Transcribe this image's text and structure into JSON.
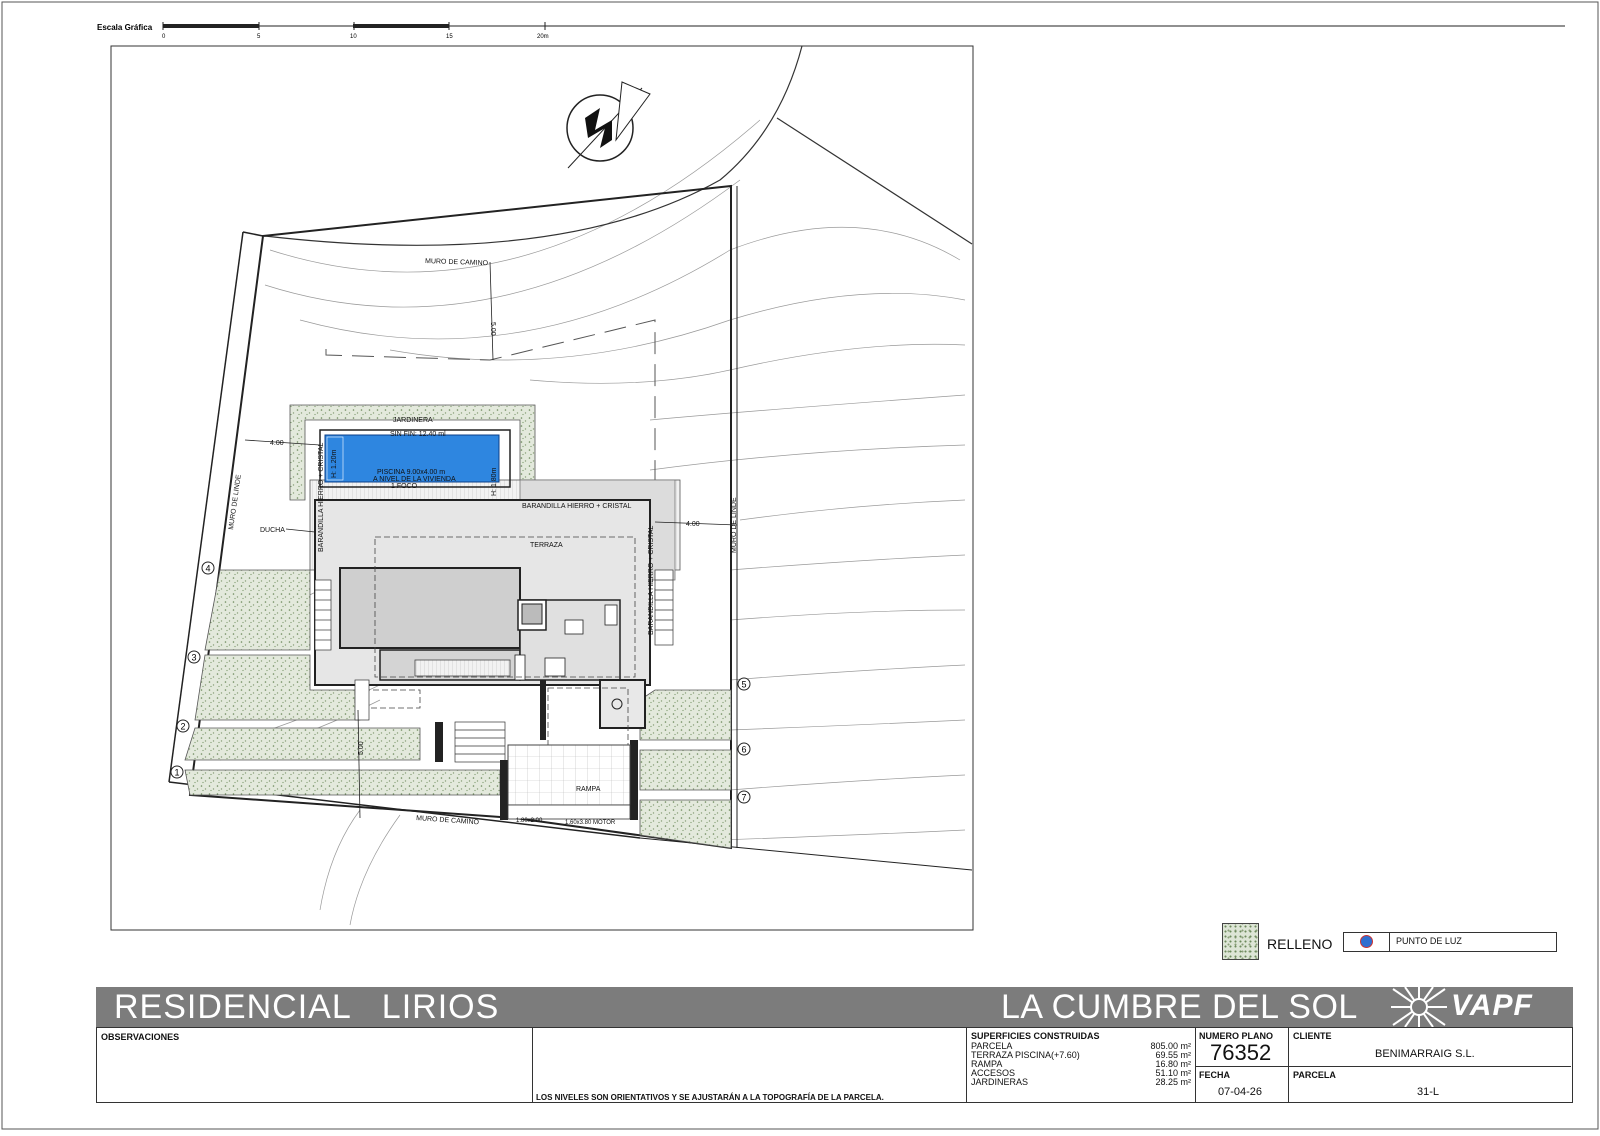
{
  "scale": {
    "title": "Escala Gráfica",
    "ticks": [
      "0",
      "5",
      "10",
      "15",
      "20m"
    ]
  },
  "plan": {
    "muro_camino_top": "MURO DE CAMINO",
    "muro_camino_bottom": "MURO DE CAMINO",
    "muro_linde_left": "MURO DE LINDE",
    "muro_linde_right": "MURO DE LINDE",
    "jardinera": "JARDINERA",
    "sin_fin": "SIN FIN: 12.40 ml",
    "piscina_line1": "PISCINA 9.00x4.00 m",
    "piscina_line2": "A NIVEL DE LA VIVIENDA",
    "piscina_line3": "1 FOCO",
    "h_120": "H: 1.20m",
    "h_180": "H: 1.80m",
    "barandilla_top": "BARANDILLA HIERRO + CRISTAL",
    "barandilla_left": "BARANDILLA HIERRO + CRISTAL",
    "barandilla_right": "BARANDILLA HIERRO + CRISTAL",
    "terraza": "TERRAZA",
    "ducha": "DUCHA",
    "rampa": "RAMPA",
    "puerta_1": "1.80x2.00",
    "puerta_2": "1.60x3.80 MOTOR",
    "dim_500_top": "5.00",
    "dim_500_bottom": "5.00",
    "dim_400_left": "4.00",
    "dim_400_right": "4.00",
    "markers": [
      "1",
      "2",
      "3",
      "4",
      "5",
      "6",
      "7"
    ]
  },
  "legend": {
    "relleno": "RELLENO",
    "punto_luz": "PUNTO DE LUZ"
  },
  "title_band": {
    "project": "RESIDENCIAL   LIRIOS",
    "location": "LA CUMBRE DEL SOL",
    "logo": "VAPF"
  },
  "info": {
    "observaciones_hdr": "OBSERVACIONES",
    "nota": "LOS NIVELES SON ORIENTATIVOS Y SE AJUSTARÁN A LA TOPOGRAFÍA DE LA PARCELA.",
    "superficies_hdr": "SUPERFICIES CONSTRUIDAS",
    "superficies": [
      {
        "label": "PARCELA",
        "value": "805.00 m²"
      },
      {
        "label": "TERRAZA PISCINA(+7.60)",
        "value": "69.55 m²"
      },
      {
        "label": "RAMPA",
        "value": "16.80 m²"
      },
      {
        "label": "ACCESOS",
        "value": "51.10 m²"
      },
      {
        "label": "JARDINERAS",
        "value": "28.25 m²"
      }
    ],
    "numero_plano_hdr": "NUMERO PLANO",
    "numero_plano": "76352",
    "fecha_hdr": "FECHA",
    "fecha": "07-04-26",
    "cliente_hdr": "CLIENTE",
    "cliente": "BENIMARRAIG S.L.",
    "parcela_hdr": "PARCELA",
    "parcela": "31-L"
  },
  "colors": {
    "pool": "#2e86e0",
    "band": "#7c7c7c",
    "fill": "#dde5d6",
    "house": "#d8d8d8"
  }
}
